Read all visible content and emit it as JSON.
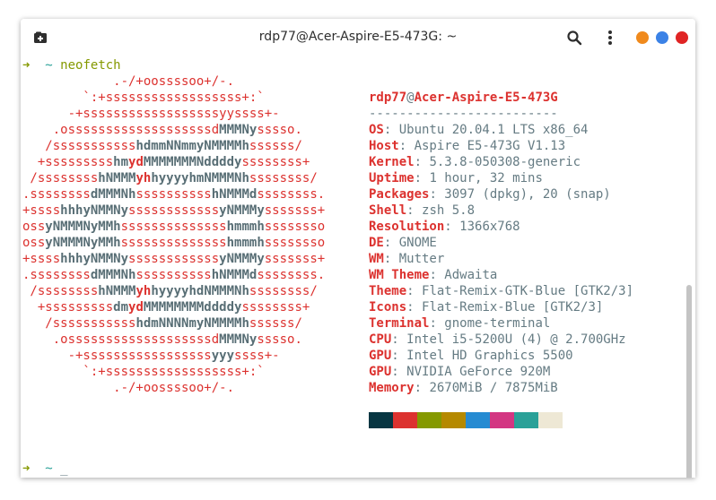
{
  "window": {
    "title": "rdp77@Acer-Aspire-E5-473G: ~"
  },
  "icons": {
    "new_tab": "new-tab-icon",
    "search": "search-icon",
    "menu": "kebab-menu-icon"
  },
  "colors": {
    "minimize": "#f08a1c",
    "maximize": "#3b82e6",
    "close": "#e02424"
  },
  "prompt": {
    "arrow": "➜",
    "dir": "~",
    "command": "neofetch",
    "cursor": "_"
  },
  "logo": [
    [
      [
        "r",
        "            .-/+oossssoo+/-."
      ]
    ],
    [
      [
        "r",
        "        `:+ssssssssssssssssss+:`"
      ]
    ],
    [
      [
        "r",
        "      -+ssssssssssssssssssyyssss+-"
      ]
    ],
    [
      [
        "r",
        "    .osssssssssssssssssssd"
      ],
      [
        "b",
        "MMMNy"
      ],
      [
        "r",
        "sssso."
      ]
    ],
    [
      [
        "r",
        "   /sssssssssss"
      ],
      [
        "b",
        "hdmmNNmmyNMMMMh"
      ],
      [
        "r",
        "ssssss/"
      ]
    ],
    [
      [
        "r",
        "  +sssssssss"
      ],
      [
        "b",
        "hm"
      ],
      [
        "k",
        "yd"
      ],
      [
        "b",
        "MMMMMMMNddddy"
      ],
      [
        "r",
        "ssssssss+"
      ]
    ],
    [
      [
        "r",
        " /ssssssss"
      ],
      [
        "b",
        "hNMMM"
      ],
      [
        "k",
        "yh"
      ],
      [
        "b",
        "hyyyyhmNMMMNh"
      ],
      [
        "r",
        "ssssssss/"
      ]
    ],
    [
      [
        "r",
        ".ssssssss"
      ],
      [
        "b",
        "dMMMNh"
      ],
      [
        "r",
        "ssssssssss"
      ],
      [
        "b",
        "hNMMMd"
      ],
      [
        "r",
        "ssssssss."
      ]
    ],
    [
      [
        "r",
        "+ssss"
      ],
      [
        "b",
        "hhhyNMMNy"
      ],
      [
        "r",
        "ssssssssssss"
      ],
      [
        "b",
        "yNMMMy"
      ],
      [
        "r",
        "sssssss+"
      ]
    ],
    [
      [
        "r",
        "oss"
      ],
      [
        "b",
        "yNMMMNyMMh"
      ],
      [
        "r",
        "ssssssssssssss"
      ],
      [
        "b",
        "hmmmh"
      ],
      [
        "r",
        "ssssssso"
      ]
    ],
    [
      [
        "r",
        "oss"
      ],
      [
        "b",
        "yNMMMNyMMh"
      ],
      [
        "r",
        "ssssssssssssss"
      ],
      [
        "b",
        "hmmmh"
      ],
      [
        "r",
        "ssssssso"
      ]
    ],
    [
      [
        "r",
        "+ssss"
      ],
      [
        "b",
        "hhhyNMMNy"
      ],
      [
        "r",
        "ssssssssssss"
      ],
      [
        "b",
        "yNMMMy"
      ],
      [
        "r",
        "sssssss+"
      ]
    ],
    [
      [
        "r",
        ".ssssssss"
      ],
      [
        "b",
        "dMMMNh"
      ],
      [
        "r",
        "ssssssssss"
      ],
      [
        "b",
        "hNMMMd"
      ],
      [
        "r",
        "ssssssss."
      ]
    ],
    [
      [
        "r",
        " /ssssssss"
      ],
      [
        "b",
        "hNMMM"
      ],
      [
        "k",
        "yh"
      ],
      [
        "b",
        "hyyyyhdNMMMNh"
      ],
      [
        "r",
        "ssssssss/"
      ]
    ],
    [
      [
        "r",
        "  +sssssssss"
      ],
      [
        "b",
        "dm"
      ],
      [
        "k",
        "yd"
      ],
      [
        "b",
        "MMMMMMMMddddy"
      ],
      [
        "r",
        "ssssssss+"
      ]
    ],
    [
      [
        "r",
        "   /sssssssssss"
      ],
      [
        "b",
        "hdmNNNNmyNMMMMh"
      ],
      [
        "r",
        "ssssss/"
      ]
    ],
    [
      [
        "r",
        "    .osssssssssssssssssssd"
      ],
      [
        "b",
        "MMMNy"
      ],
      [
        "r",
        "sssso."
      ]
    ],
    [
      [
        "r",
        "      -+sssssssssssssssss"
      ],
      [
        "b",
        "yyy"
      ],
      [
        "r",
        "ssss+-"
      ]
    ],
    [
      [
        "r",
        "        `:+ssssssssssssssssss+:`"
      ]
    ],
    [
      [
        "r",
        "            .-/+oossssoo+/-."
      ]
    ]
  ],
  "header": {
    "user": "rdp77",
    "at": "@",
    "host": "Acer-Aspire-E5-473G",
    "separator": "-------------------------"
  },
  "info": [
    {
      "key": "OS",
      "value": "Ubuntu 20.04.1 LTS x86_64"
    },
    {
      "key": "Host",
      "value": "Aspire E5-473G V1.13"
    },
    {
      "key": "Kernel",
      "value": "5.3.8-050308-generic"
    },
    {
      "key": "Uptime",
      "value": "1 hour, 32 mins"
    },
    {
      "key": "Packages",
      "value": "3097 (dpkg), 20 (snap)"
    },
    {
      "key": "Shell",
      "value": "zsh 5.8"
    },
    {
      "key": "Resolution",
      "value": "1366x768"
    },
    {
      "key": "DE",
      "value": "GNOME"
    },
    {
      "key": "WM",
      "value": "Mutter"
    },
    {
      "key": "WM Theme",
      "value": "Adwaita"
    },
    {
      "key": "Theme",
      "value": "Flat-Remix-GTK-Blue [GTK2/3]"
    },
    {
      "key": "Icons",
      "value": "Flat-Remix-Blue [GTK2/3]"
    },
    {
      "key": "Terminal",
      "value": "gnome-terminal"
    },
    {
      "key": "CPU",
      "value": "Intel i5-5200U (4) @ 2.700GHz"
    },
    {
      "key": "GPU",
      "value": "Intel HD Graphics 5500"
    },
    {
      "key": "GPU",
      "value": "NVIDIA GeForce 920M"
    },
    {
      "key": "Memory",
      "value": "2670MiB / 7875MiB"
    }
  ],
  "palette": [
    "#073642",
    "#dc322f",
    "#859900",
    "#b58900",
    "#268bd2",
    "#d33682",
    "#2aa198",
    "#eee8d5"
  ]
}
